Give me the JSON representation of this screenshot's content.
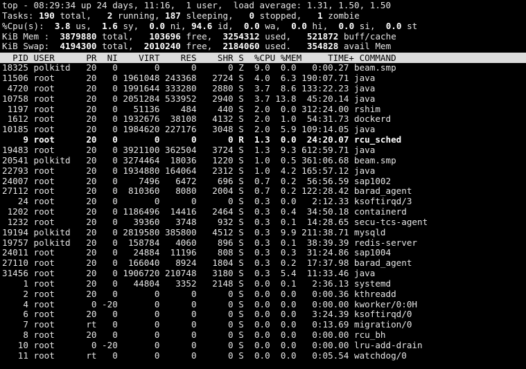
{
  "terminal": {
    "program": "top",
    "colors": {
      "background": "#000000",
      "foreground": "#e6e6e6",
      "header_background": "#dcdcdc",
      "header_foreground": "#000000",
      "bold_foreground": "#ffffff"
    }
  },
  "summary": {
    "uptime_line": {
      "program": "top",
      "dash": "-",
      "time": "08:29:34",
      "up_label": "up",
      "uptime": "24 days, 11:16,",
      "users": "1 user,",
      "load_label": "load average:",
      "load_1": "1.31,",
      "load_5": "1.50,",
      "load_15": "1.50",
      "full": "top - 08:29:34 up 24 days, 11:16,  1 user,  load average: 1.31, 1.50, 1.50"
    },
    "tasks_line": {
      "label": "Tasks:",
      "total": "190",
      "total_label": "total,",
      "running": "2",
      "running_label": "running,",
      "sleeping": "187",
      "sleeping_label": "sleeping,",
      "stopped": "0",
      "stopped_label": "stopped,",
      "zombie": "1",
      "zombie_label": "zombie"
    },
    "cpu_line": {
      "label": "%Cpu(s):",
      "us": "3.8",
      "us_label": "us,",
      "sy": "1.6",
      "sy_label": "sy,",
      "ni": "0.0",
      "ni_label": "ni,",
      "id": "94.6",
      "id_label": "id,",
      "wa": "0.0",
      "wa_label": "wa,",
      "hi": "0.0",
      "hi_label": "hi,",
      "si": "0.0",
      "si_label": "si,",
      "st": "0.0",
      "st_label": "st"
    },
    "mem_line": {
      "label": "KiB Mem :",
      "total": "3879880",
      "total_label": "total,",
      "free": "103696",
      "free_label": "free,",
      "used": "3254312",
      "used_label": "used,",
      "buff": "521872",
      "buff_label": "buff/cache"
    },
    "swap_line": {
      "label": "KiB Swap:",
      "total": "4194300",
      "total_label": "total,",
      "free": "2010240",
      "free_label": "free,",
      "used": "2184060",
      "used_label": "used.",
      "avail": "354828",
      "avail_label": "avail Mem"
    }
  },
  "table": {
    "columns": [
      "PID",
      "USER",
      "PR",
      "NI",
      "VIRT",
      "RES",
      "SHR",
      "S",
      "%CPU",
      "%MEM",
      "TIME+",
      "COMMAND"
    ],
    "header_text": "  PID USER      PR  NI    VIRT    RES    SHR S  %CPU %MEM     TIME+ COMMAND",
    "rows": [
      {
        "pid": "18325",
        "user": "polkitd",
        "pr": "20",
        "ni": "0",
        "virt": "0",
        "res": "0",
        "shr": "0",
        "s": "Z",
        "cpu": "9.0",
        "mem": "0.0",
        "time": "0:00.27",
        "command": "beam.smp",
        "bold": false
      },
      {
        "pid": "11506",
        "user": "root",
        "pr": "20",
        "ni": "0",
        "virt": "1961048",
        "res": "243368",
        "shr": "2724",
        "s": "S",
        "cpu": "4.0",
        "mem": "6.3",
        "time": "190:07.71",
        "command": "java",
        "bold": false
      },
      {
        "pid": "4720",
        "user": "root",
        "pr": "20",
        "ni": "0",
        "virt": "1991644",
        "res": "333280",
        "shr": "2880",
        "s": "S",
        "cpu": "3.7",
        "mem": "8.6",
        "time": "133:22.23",
        "command": "java",
        "bold": false
      },
      {
        "pid": "10758",
        "user": "root",
        "pr": "20",
        "ni": "0",
        "virt": "2051284",
        "res": "533952",
        "shr": "2940",
        "s": "S",
        "cpu": "3.7",
        "mem": "13.8",
        "time": "45:20.14",
        "command": "java",
        "bold": false
      },
      {
        "pid": "1197",
        "user": "root",
        "pr": "20",
        "ni": "0",
        "virt": "51136",
        "res": "484",
        "shr": "440",
        "s": "S",
        "cpu": "2.0",
        "mem": "0.0",
        "time": "312:24.00",
        "command": "rshim",
        "bold": false
      },
      {
        "pid": "1612",
        "user": "root",
        "pr": "20",
        "ni": "0",
        "virt": "1932676",
        "res": "38108",
        "shr": "4132",
        "s": "S",
        "cpu": "2.0",
        "mem": "1.0",
        "time": "54:31.73",
        "command": "dockerd",
        "bold": false
      },
      {
        "pid": "10185",
        "user": "root",
        "pr": "20",
        "ni": "0",
        "virt": "1984620",
        "res": "227176",
        "shr": "3048",
        "s": "S",
        "cpu": "2.0",
        "mem": "5.9",
        "time": "109:14.05",
        "command": "java",
        "bold": false
      },
      {
        "pid": "9",
        "user": "root",
        "pr": "20",
        "ni": "0",
        "virt": "0",
        "res": "0",
        "shr": "0",
        "s": "R",
        "cpu": "1.3",
        "mem": "0.0",
        "time": "24:20.07",
        "command": "rcu_sched",
        "bold": true
      },
      {
        "pid": "19483",
        "user": "root",
        "pr": "20",
        "ni": "0",
        "virt": "3921100",
        "res": "362504",
        "shr": "3724",
        "s": "S",
        "cpu": "1.3",
        "mem": "9.3",
        "time": "612:59.71",
        "command": "java",
        "bold": false
      },
      {
        "pid": "20541",
        "user": "polkitd",
        "pr": "20",
        "ni": "0",
        "virt": "3274464",
        "res": "18036",
        "shr": "1220",
        "s": "S",
        "cpu": "1.0",
        "mem": "0.5",
        "time": "361:06.68",
        "command": "beam.smp",
        "bold": false
      },
      {
        "pid": "22793",
        "user": "root",
        "pr": "20",
        "ni": "0",
        "virt": "1934880",
        "res": "164064",
        "shr": "2312",
        "s": "S",
        "cpu": "1.0",
        "mem": "4.2",
        "time": "165:57.12",
        "command": "java",
        "bold": false
      },
      {
        "pid": "24007",
        "user": "root",
        "pr": "20",
        "ni": "0",
        "virt": "7496",
        "res": "6472",
        "shr": "696",
        "s": "S",
        "cpu": "0.7",
        "mem": "0.2",
        "time": "56:56.59",
        "command": "sap1002",
        "bold": false
      },
      {
        "pid": "27112",
        "user": "root",
        "pr": "20",
        "ni": "0",
        "virt": "810360",
        "res": "8080",
        "shr": "2004",
        "s": "S",
        "cpu": "0.7",
        "mem": "0.2",
        "time": "122:28.42",
        "command": "barad_agent",
        "bold": false
      },
      {
        "pid": "24",
        "user": "root",
        "pr": "20",
        "ni": "0",
        "virt": "0",
        "res": "0",
        "shr": "0",
        "s": "S",
        "cpu": "0.3",
        "mem": "0.0",
        "time": "2:12.33",
        "command": "ksoftirqd/3",
        "bold": false
      },
      {
        "pid": "1202",
        "user": "root",
        "pr": "20",
        "ni": "0",
        "virt": "1186496",
        "res": "14416",
        "shr": "2464",
        "s": "S",
        "cpu": "0.3",
        "mem": "0.4",
        "time": "34:50.18",
        "command": "containerd",
        "bold": false
      },
      {
        "pid": "1232",
        "user": "root",
        "pr": "20",
        "ni": "0",
        "virt": "39360",
        "res": "3748",
        "shr": "932",
        "s": "S",
        "cpu": "0.3",
        "mem": "0.1",
        "time": "14:28.65",
        "command": "secu-tcs-agent",
        "bold": false
      },
      {
        "pid": "19194",
        "user": "polkitd",
        "pr": "20",
        "ni": "0",
        "virt": "2819580",
        "res": "385800",
        "shr": "4512",
        "s": "S",
        "cpu": "0.3",
        "mem": "9.9",
        "time": "211:38.71",
        "command": "mysqld",
        "bold": false
      },
      {
        "pid": "19757",
        "user": "polkitd",
        "pr": "20",
        "ni": "0",
        "virt": "158784",
        "res": "4060",
        "shr": "896",
        "s": "S",
        "cpu": "0.3",
        "mem": "0.1",
        "time": "38:39.39",
        "command": "redis-server",
        "bold": false
      },
      {
        "pid": "24011",
        "user": "root",
        "pr": "20",
        "ni": "0",
        "virt": "24884",
        "res": "11196",
        "shr": "808",
        "s": "S",
        "cpu": "0.3",
        "mem": "0.3",
        "time": "31:24.86",
        "command": "sap1004",
        "bold": false
      },
      {
        "pid": "27110",
        "user": "root",
        "pr": "20",
        "ni": "0",
        "virt": "166040",
        "res": "8924",
        "shr": "1804",
        "s": "S",
        "cpu": "0.3",
        "mem": "0.2",
        "time": "17:37.98",
        "command": "barad_agent",
        "bold": false
      },
      {
        "pid": "31456",
        "user": "root",
        "pr": "20",
        "ni": "0",
        "virt": "1906720",
        "res": "210748",
        "shr": "3180",
        "s": "S",
        "cpu": "0.3",
        "mem": "5.4",
        "time": "11:33.46",
        "command": "java",
        "bold": false
      },
      {
        "pid": "1",
        "user": "root",
        "pr": "20",
        "ni": "0",
        "virt": "44804",
        "res": "3352",
        "shr": "2148",
        "s": "S",
        "cpu": "0.0",
        "mem": "0.1",
        "time": "2:36.13",
        "command": "systemd",
        "bold": false
      },
      {
        "pid": "2",
        "user": "root",
        "pr": "20",
        "ni": "0",
        "virt": "0",
        "res": "0",
        "shr": "0",
        "s": "S",
        "cpu": "0.0",
        "mem": "0.0",
        "time": "0:00.36",
        "command": "kthreadd",
        "bold": false
      },
      {
        "pid": "4",
        "user": "root",
        "pr": "0",
        "ni": "-20",
        "virt": "0",
        "res": "0",
        "shr": "0",
        "s": "S",
        "cpu": "0.0",
        "mem": "0.0",
        "time": "0:00.00",
        "command": "kworker/0:0H",
        "bold": false
      },
      {
        "pid": "6",
        "user": "root",
        "pr": "20",
        "ni": "0",
        "virt": "0",
        "res": "0",
        "shr": "0",
        "s": "S",
        "cpu": "0.0",
        "mem": "0.0",
        "time": "3:24.39",
        "command": "ksoftirqd/0",
        "bold": false
      },
      {
        "pid": "7",
        "user": "root",
        "pr": "rt",
        "ni": "0",
        "virt": "0",
        "res": "0",
        "shr": "0",
        "s": "S",
        "cpu": "0.0",
        "mem": "0.0",
        "time": "0:13.69",
        "command": "migration/0",
        "bold": false
      },
      {
        "pid": "8",
        "user": "root",
        "pr": "20",
        "ni": "0",
        "virt": "0",
        "res": "0",
        "shr": "0",
        "s": "S",
        "cpu": "0.0",
        "mem": "0.0",
        "time": "0:00.00",
        "command": "rcu_bh",
        "bold": false
      },
      {
        "pid": "10",
        "user": "root",
        "pr": "0",
        "ni": "-20",
        "virt": "0",
        "res": "0",
        "shr": "0",
        "s": "S",
        "cpu": "0.0",
        "mem": "0.0",
        "time": "0:00.00",
        "command": "lru-add-drain",
        "bold": false
      },
      {
        "pid": "11",
        "user": "root",
        "pr": "rt",
        "ni": "0",
        "virt": "0",
        "res": "0",
        "shr": "0",
        "s": "S",
        "cpu": "0.0",
        "mem": "0.0",
        "time": "0:05.54",
        "command": "watchdog/0",
        "bold": false
      }
    ]
  }
}
